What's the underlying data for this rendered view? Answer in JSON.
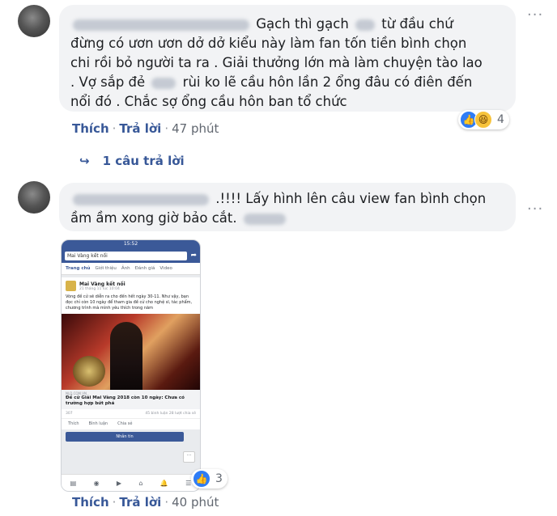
{
  "comment1": {
    "name_blurred": "Phan Ngọc Phương Linh",
    "line1_a": "Gạch thì gạch",
    "line1_b": "từ đầu chứ",
    "line2": "đừng có ươn ươn dở dở kiểu này làm fan tốn tiền bình chọn",
    "line3": "chi rồi bỏ người ta ra . Giải thưởng lớn mà làm chuyện tào lao",
    "line4_a": ". Vợ sắp đẻ",
    "line4_b": "rùi ko lẽ cầu hôn lần 2 ổng đâu có điên đến",
    "line5": "nổi đó . Chắc sợ ổng cầu hôn ban tổ chức",
    "like": "Thích",
    "reply": "Trả lời",
    "time": "47 phút",
    "reaction_count": "4",
    "replies_link": "1 câu trả lời"
  },
  "comment2": {
    "line1": ".!!!! Lấy hình lên câu view fan bình chọn",
    "line2": "ầm ầm xong giờ bảo cắt.",
    "like": "Thích",
    "reply": "Trả lời",
    "time": "40 phút",
    "reaction_count": "3"
  },
  "phone": {
    "status_time": "15:52",
    "search_text": "Mai Vàng kết nối",
    "tabs": [
      "Trang chủ",
      "Giới thiệu",
      "Ảnh",
      "Đánh giá",
      "Video"
    ],
    "page_name": "Mai Vàng kết nối",
    "post_date": "21 tháng 11 lúc 10:04",
    "post_body": "Vòng đề cử sẽ diễn ra cho đến hết ngày 30-11. Như vậy, bạn đọc chỉ còn 10 ngày để tham gia đề cử cho nghệ sĩ, tác phẩm, chương trình mà mình yêu thích trong năm",
    "link_source": "NLD.COM.VN",
    "link_title": "Đề cử Giải Mai Vàng 2018 còn 10 ngày: Chưa có trường hợp bứt phá",
    "reactions": "307",
    "comments": "45 bình luận",
    "shares": "28 lượt chia sẻ",
    "act_like": "Thích",
    "act_comment": "Bình luận",
    "act_share": "Chia sẻ",
    "message_btn": "Nhắn tin",
    "more_btn": "···"
  },
  "icons": {
    "like": "thumbs-up-icon",
    "haha": "haha-emoji-icon",
    "reply_arrow": "reply-arrow-icon",
    "more": "more-dots-icon"
  }
}
